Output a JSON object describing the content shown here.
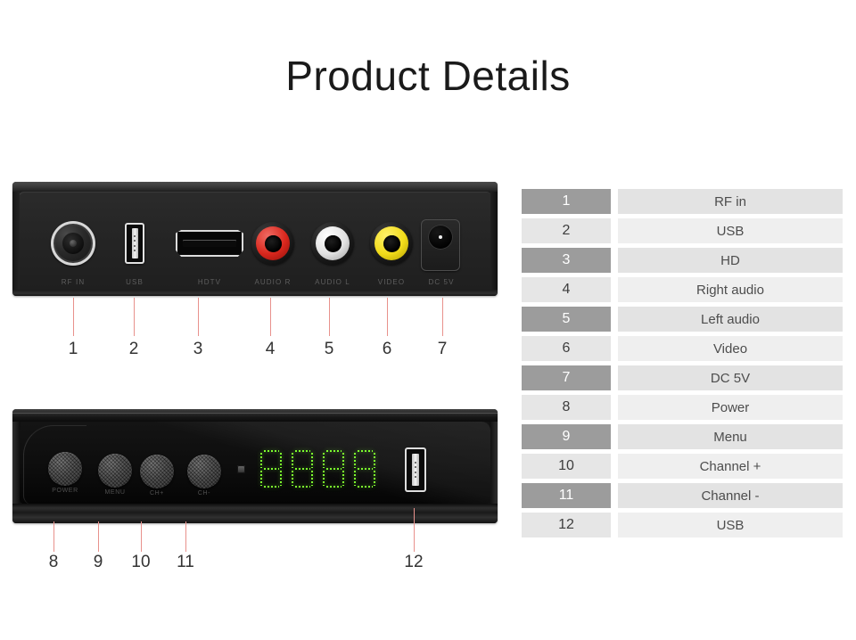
{
  "page": {
    "title": "Product Details",
    "background": "#ffffff"
  },
  "colors": {
    "title_text": "#1a1a1a",
    "legend_num_odd_bg": "#9c9c9c",
    "legend_num_odd_text": "#ffffff",
    "legend_num_even_bg": "#e6e6e6",
    "legend_num_even_text": "#3d3d3d",
    "legend_label_odd_bg": "#e3e3e3",
    "legend_label_even_bg": "#efefef",
    "legend_label_text": "#4d4d4d",
    "leader_line": "#e8918c",
    "callout_number": "#333333",
    "led_green": "#7dff2e",
    "rca_red": "#d9271d",
    "rca_white": "#e2e2e2",
    "rca_yellow": "#f2dc1a",
    "device_black": "#1c1c1c"
  },
  "back_panel": {
    "name": "Rear panel of digital TV receiver box",
    "ports": [
      {
        "id": "rf-in",
        "label": "RF IN",
        "icon": "coaxial-jack-icon",
        "callout": "1"
      },
      {
        "id": "usb",
        "label": "USB",
        "icon": "usb-port-icon",
        "callout": "2"
      },
      {
        "id": "hdtv",
        "label": "HDTV",
        "icon": "hdmi-port-icon",
        "callout": "3"
      },
      {
        "id": "audio-r",
        "label": "AUDIO R",
        "icon": "rca-jack-red-icon",
        "callout": "4"
      },
      {
        "id": "audio-l",
        "label": "AUDIO L",
        "icon": "rca-jack-white-icon",
        "callout": "5"
      },
      {
        "id": "video",
        "label": "VIDEO",
        "icon": "rca-jack-yellow-icon",
        "callout": "6"
      },
      {
        "id": "dc-5v",
        "label": "DC 5V",
        "icon": "dc-barrel-jack-icon",
        "callout": "7"
      }
    ],
    "callouts": [
      "1",
      "2",
      "3",
      "4",
      "5",
      "6",
      "7"
    ]
  },
  "front_panel": {
    "name": "Front panel of digital TV receiver box",
    "buttons": [
      {
        "id": "power",
        "label": "POWER",
        "callout": "8"
      },
      {
        "id": "menu",
        "label": "MENU",
        "callout": "9"
      },
      {
        "id": "channel-up",
        "label": "CH+",
        "callout": "10"
      },
      {
        "id": "channel-dn",
        "label": "CH-",
        "callout": "11"
      }
    ],
    "display": {
      "icon": "seven-segment-led-display",
      "value": "8888",
      "digits": [
        "8",
        "8",
        "8",
        "8"
      ]
    },
    "ir_receiver": {
      "icon": "ir-sensor-icon"
    },
    "usb": {
      "id": "usb-front",
      "icon": "usb-port-icon",
      "callout": "12"
    },
    "callouts": [
      "8",
      "9",
      "10",
      "11",
      "12"
    ]
  },
  "legend": {
    "rows": [
      {
        "num": "1",
        "label": "RF in"
      },
      {
        "num": "2",
        "label": "USB"
      },
      {
        "num": "3",
        "label": "HD"
      },
      {
        "num": "4",
        "label": "Right audio"
      },
      {
        "num": "5",
        "label": "Left audio"
      },
      {
        "num": "6",
        "label": "Video"
      },
      {
        "num": "7",
        "label": "DC 5V"
      },
      {
        "num": "8",
        "label": "Power"
      },
      {
        "num": "9",
        "label": "Menu"
      },
      {
        "num": "10",
        "label": "Channel +"
      },
      {
        "num": "11",
        "label": "Channel -"
      },
      {
        "num": "12",
        "label": "USB"
      }
    ]
  }
}
